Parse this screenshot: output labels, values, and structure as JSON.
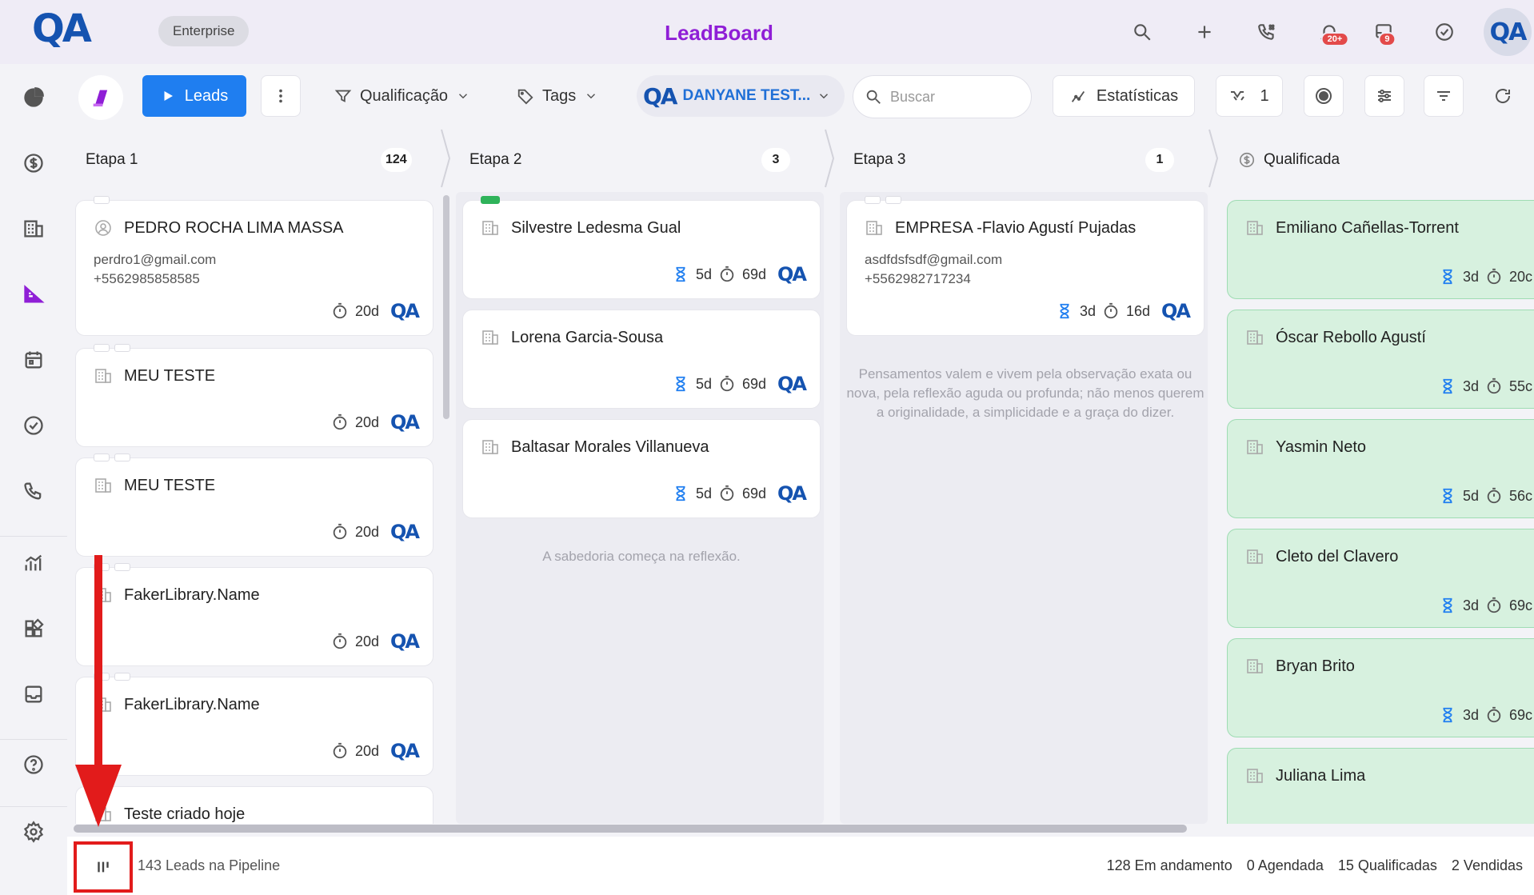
{
  "header": {
    "logo": "QA",
    "plan": "Enterprise",
    "title": "LeadBoard",
    "notifications": {
      "bell": "20+",
      "inbox": "9"
    },
    "avatar": "QA"
  },
  "toolbar": {
    "leads_label": "Leads",
    "qualification_label": "Qualificação",
    "tags_label": "Tags",
    "user_name": "DANYANE TEST...",
    "search_placeholder": "Buscar",
    "stats_label": "Estatísticas",
    "filter_count": "1"
  },
  "columns": [
    {
      "name": "Etapa 1",
      "count": "124"
    },
    {
      "name": "Etapa 2",
      "count": "3"
    },
    {
      "name": "Etapa 3",
      "count": "1"
    },
    {
      "name": "Qualificada"
    }
  ],
  "etapa1_cards": [
    {
      "name": "PEDRO ROCHA LIMA MASSA",
      "email": "perdro1@gmail.com",
      "phone": "+5562985858585",
      "time": "20d"
    },
    {
      "name": "MEU TESTE",
      "time": "20d"
    },
    {
      "name": "MEU TESTE",
      "time": "20d"
    },
    {
      "name": "FakerLibrary.Name",
      "time": "20d"
    },
    {
      "name": "FakerLibrary.Name",
      "time": "20d"
    },
    {
      "name": "Teste criado hoje"
    }
  ],
  "etapa2_cards": [
    {
      "name": "Silvestre Ledesma Gual",
      "wait": "5d",
      "time": "69d"
    },
    {
      "name": "Lorena Garcia-Sousa",
      "wait": "5d",
      "time": "69d"
    },
    {
      "name": "Baltasar Morales Villanueva",
      "wait": "5d",
      "time": "69d"
    }
  ],
  "etapa2_empty": "A sabedoria começa na reflexão.",
  "etapa3_cards": [
    {
      "name": "EMPRESA -Flavio Agustí Pujadas",
      "email": "asdfdsfsdf@gmail.com",
      "phone": "+5562982717234",
      "wait": "3d",
      "time": "16d"
    }
  ],
  "etapa3_empty": "Pensamentos valem e vivem pela observação exata ou nova, pela reflexão aguda ou profunda; não menos querem a originalidade, a simplicidade e a graça do dizer.",
  "qualificada_cards": [
    {
      "name": "Emiliano Cañellas-Torrent",
      "wait": "3d",
      "time": "20c"
    },
    {
      "name": "Óscar Rebollo Agustí",
      "wait": "3d",
      "time": "55c"
    },
    {
      "name": "Yasmin Neto",
      "wait": "5d",
      "time": "56c"
    },
    {
      "name": "Cleto del Clavero",
      "wait": "3d",
      "time": "69c"
    },
    {
      "name": "Bryan Brito",
      "wait": "3d",
      "time": "69c"
    },
    {
      "name": "Juliana Lima"
    }
  ],
  "footer": {
    "total": "143 Leads na Pipeline",
    "in_progress": "128 Em andamento",
    "scheduled": "0 Agendada",
    "qualified": "15 Qualificadas",
    "sold": "2 Vendidas"
  },
  "colors": {
    "accent": "#1f7ef0",
    "brand": "#8f1ed6",
    "qualified_bg": "#d7f1df",
    "annotation": "#e21b1b"
  }
}
